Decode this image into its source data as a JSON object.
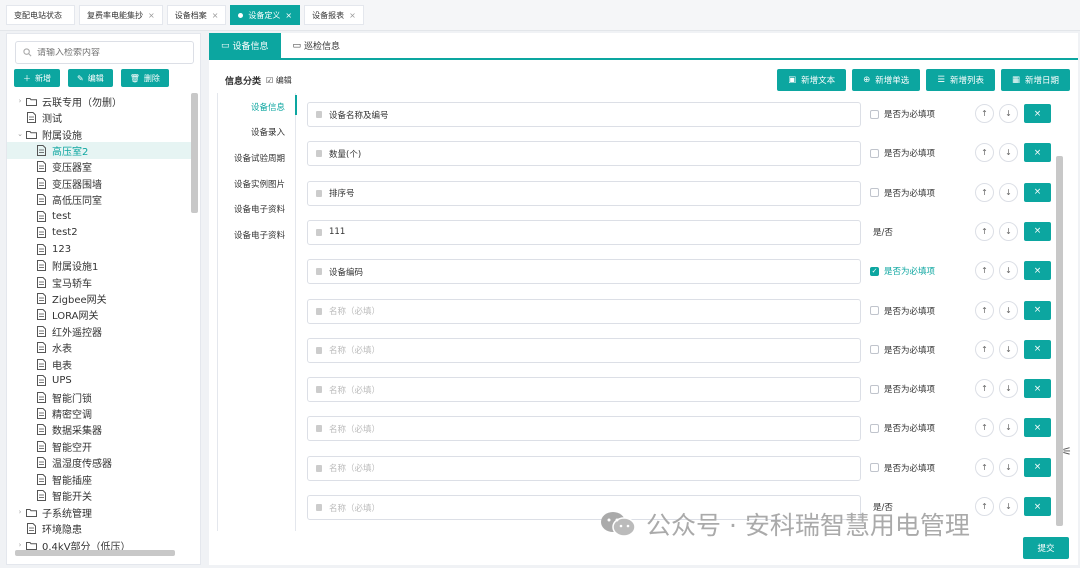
{
  "top_tabs": [
    {
      "label": "变配电站状态",
      "close": ""
    },
    {
      "label": "复费率电能集抄",
      "close": "×"
    },
    {
      "label": "设备档案",
      "close": "×"
    },
    {
      "label": "设备定义",
      "close": "×",
      "active": true
    },
    {
      "label": "设备报表",
      "close": "×"
    }
  ],
  "left": {
    "search_placeholder": "请输入检索内容",
    "btn_add": "新增",
    "btn_edit": "编辑",
    "btn_delete": "删除",
    "tree": [
      {
        "label": "云联专用（勿删）",
        "level": 0,
        "arrow": "›",
        "icon": "folder"
      },
      {
        "label": "测试",
        "level": 0,
        "arrow": "",
        "icon": "doc"
      },
      {
        "label": "附属设施",
        "level": 0,
        "arrow": "⌄",
        "icon": "folder"
      },
      {
        "label": "高压室2",
        "level": 1,
        "arrow": "",
        "icon": "doc",
        "selected": true
      },
      {
        "label": "变压器室",
        "level": 1,
        "arrow": "",
        "icon": "doc"
      },
      {
        "label": "变压器围墙",
        "level": 1,
        "arrow": "",
        "icon": "doc"
      },
      {
        "label": "高低压同室",
        "level": 1,
        "arrow": "",
        "icon": "doc"
      },
      {
        "label": "test",
        "level": 1,
        "arrow": "",
        "icon": "doc"
      },
      {
        "label": "test2",
        "level": 1,
        "arrow": "",
        "icon": "doc"
      },
      {
        "label": "123",
        "level": 1,
        "arrow": "",
        "icon": "doc"
      },
      {
        "label": "附属设施1",
        "level": 1,
        "arrow": "",
        "icon": "doc"
      },
      {
        "label": "宝马轿车",
        "level": 1,
        "arrow": "",
        "icon": "doc"
      },
      {
        "label": "Zigbee网关",
        "level": 1,
        "arrow": "",
        "icon": "doc"
      },
      {
        "label": "LORA网关",
        "level": 1,
        "arrow": "",
        "icon": "doc"
      },
      {
        "label": "红外遥控器",
        "level": 1,
        "arrow": "",
        "icon": "doc"
      },
      {
        "label": "水表",
        "level": 1,
        "arrow": "",
        "icon": "doc"
      },
      {
        "label": "电表",
        "level": 1,
        "arrow": "",
        "icon": "doc"
      },
      {
        "label": "UPS",
        "level": 1,
        "arrow": "",
        "icon": "doc"
      },
      {
        "label": "智能门锁",
        "level": 1,
        "arrow": "",
        "icon": "doc"
      },
      {
        "label": "精密空调",
        "level": 1,
        "arrow": "",
        "icon": "doc"
      },
      {
        "label": "数据采集器",
        "level": 1,
        "arrow": "",
        "icon": "doc"
      },
      {
        "label": "智能空开",
        "level": 1,
        "arrow": "",
        "icon": "doc"
      },
      {
        "label": "温湿度传感器",
        "level": 1,
        "arrow": "",
        "icon": "doc"
      },
      {
        "label": "智能插座",
        "level": 1,
        "arrow": "",
        "icon": "doc"
      },
      {
        "label": "智能开关",
        "level": 1,
        "arrow": "",
        "icon": "doc"
      },
      {
        "label": "子系统管理",
        "level": 0,
        "arrow": "›",
        "icon": "folder"
      },
      {
        "label": "环境隐患",
        "level": 0,
        "arrow": "",
        "icon": "doc"
      },
      {
        "label": "0.4kV部分（低压）",
        "level": 0,
        "arrow": "›",
        "icon": "folder"
      }
    ]
  },
  "main": {
    "tab_device_info": "设备信息",
    "tab_patrol_info": "巡检信息",
    "info_category": "信息分类",
    "edit_label": "编辑",
    "btn_add_text": "新增文本",
    "btn_add_single": "新增单选",
    "btn_add_list": "新增列表",
    "btn_add_date": "新增日期",
    "menu": [
      "设备信息",
      "设备录入",
      "设备试验周期",
      "设备实例图片",
      "设备电子资料",
      "设备电子资料"
    ],
    "rows": [
      {
        "value": "设备名称及编号",
        "placeholder": "",
        "type": "check",
        "checked": false,
        "label": "是否为必填项"
      },
      {
        "value": "数量(个)",
        "placeholder": "",
        "type": "check",
        "checked": false,
        "label": "是否为必填项"
      },
      {
        "value": "排序号",
        "placeholder": "",
        "type": "check",
        "checked": false,
        "label": "是否为必填项"
      },
      {
        "value": "111",
        "placeholder": "",
        "type": "yn",
        "checked": false,
        "label": "是/否"
      },
      {
        "value": "设备编码",
        "placeholder": "",
        "type": "check",
        "checked": true,
        "label": "是否为必填项"
      },
      {
        "value": "",
        "placeholder": "名称（必填）",
        "type": "check",
        "checked": false,
        "label": "是否为必填项"
      },
      {
        "value": "",
        "placeholder": "名称（必填）",
        "type": "check",
        "checked": false,
        "label": "是否为必填项"
      },
      {
        "value": "",
        "placeholder": "名称（必填）",
        "type": "check",
        "checked": false,
        "label": "是否为必填项"
      },
      {
        "value": "",
        "placeholder": "名称（必填）",
        "type": "check",
        "checked": false,
        "label": "是否为必填项"
      },
      {
        "value": "",
        "placeholder": "名称（必填）",
        "type": "check",
        "checked": false,
        "label": "是否为必填项"
      },
      {
        "value": "",
        "placeholder": "名称（必填）",
        "type": "yn",
        "checked": false,
        "label": "是/否"
      }
    ],
    "up_arrow": "↑",
    "down_arrow": "↓",
    "delete_x": "×",
    "submit": "提交"
  },
  "watermark": "公众号 · 安科瑞智慧用电管理",
  "colors": {
    "accent": "#0ca6a0"
  }
}
